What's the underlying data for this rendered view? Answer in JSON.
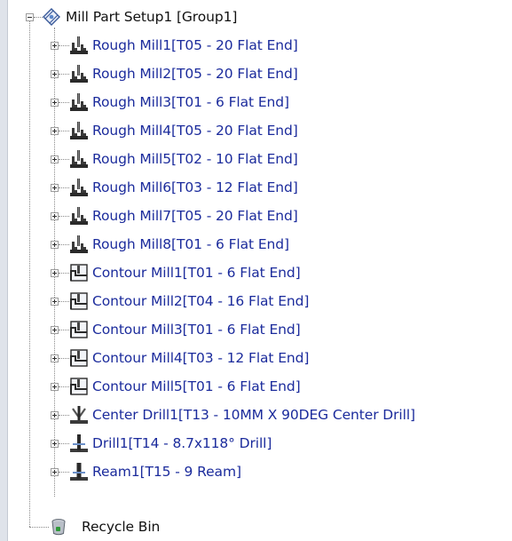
{
  "tree": {
    "root": {
      "label": "Mill Part Setup1 [Group1]",
      "icon": "mill-setup-icon",
      "expanded": true
    },
    "operations": [
      {
        "label": "Rough Mill1[T05 - 20 Flat End]",
        "icon": "rough-mill-icon"
      },
      {
        "label": "Rough Mill2[T05 - 20 Flat End]",
        "icon": "rough-mill-icon"
      },
      {
        "label": "Rough Mill3[T01 - 6 Flat End]",
        "icon": "rough-mill-icon"
      },
      {
        "label": "Rough Mill4[T05 - 20 Flat End]",
        "icon": "rough-mill-icon"
      },
      {
        "label": "Rough Mill5[T02 - 10 Flat End]",
        "icon": "rough-mill-icon"
      },
      {
        "label": "Rough Mill6[T03 - 12 Flat End]",
        "icon": "rough-mill-icon"
      },
      {
        "label": "Rough Mill7[T05 - 20 Flat End]",
        "icon": "rough-mill-icon"
      },
      {
        "label": "Rough Mill8[T01 - 6 Flat End]",
        "icon": "rough-mill-icon"
      },
      {
        "label": "Contour Mill1[T01 - 6 Flat End]",
        "icon": "contour-mill-icon"
      },
      {
        "label": "Contour Mill2[T04 - 16 Flat End]",
        "icon": "contour-mill-icon"
      },
      {
        "label": "Contour Mill3[T01 - 6 Flat End]",
        "icon": "contour-mill-icon"
      },
      {
        "label": "Contour Mill4[T03 - 12 Flat End]",
        "icon": "contour-mill-icon"
      },
      {
        "label": "Contour Mill5[T01 - 6 Flat End]",
        "icon": "contour-mill-icon"
      },
      {
        "label": "Center Drill1[T13 - 10MM X 90DEG Center Drill]",
        "icon": "center-drill-icon"
      },
      {
        "label": "Drill1[T14 - 8.7x118° Drill]",
        "icon": "drill-icon"
      },
      {
        "label": "Ream1[T15 - 9 Ream]",
        "icon": "ream-icon"
      }
    ],
    "recycle_bin": {
      "label": "Recycle Bin",
      "icon": "recycle-bin-icon"
    }
  },
  "colors": {
    "operation_text": "#1b2b9c",
    "plain_text": "#111111",
    "tree_lines": "#8a8a8a",
    "left_strip": "#dfe3ea"
  }
}
